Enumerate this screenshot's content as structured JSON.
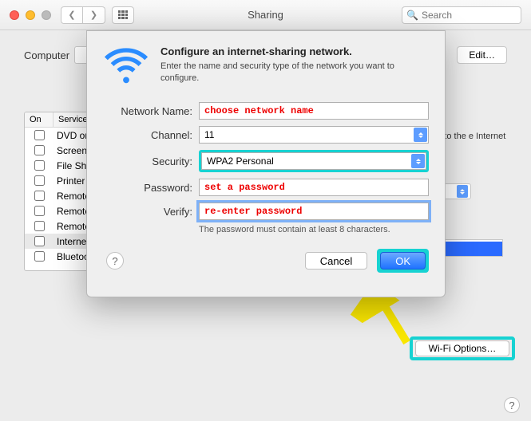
{
  "window": {
    "title": "Sharing",
    "search_placeholder": "Search",
    "computer_label": "Computer",
    "edit_button": "Edit…"
  },
  "services": {
    "col_on": "On",
    "col_service": "Service",
    "items": [
      {
        "label": "DVD or"
      },
      {
        "label": "Screen"
      },
      {
        "label": "File Sha"
      },
      {
        "label": "Printer"
      },
      {
        "label": "Remote"
      },
      {
        "label": "Remote"
      },
      {
        "label": "Remote"
      },
      {
        "label": "Internet",
        "selected": true
      },
      {
        "label": "Bluetoo"
      }
    ]
  },
  "right_info": "ction to the e Internet",
  "wifi_options_button": "Wi-Fi Options…",
  "sheet": {
    "title": "Configure an internet-sharing network.",
    "subtitle": "Enter the name and security type of the network you want to configure.",
    "labels": {
      "network_name": "Network Name:",
      "channel": "Channel:",
      "security": "Security:",
      "password": "Password:",
      "verify": "Verify:"
    },
    "values": {
      "network_name": "choose network name",
      "channel": "11",
      "security": "WPA2 Personal",
      "password": "set a password",
      "verify": "re-enter password"
    },
    "hint": "The password must contain at least 8 characters.",
    "cancel": "Cancel",
    "ok": "OK"
  },
  "annotation_colors": {
    "highlight": "#17d2d2",
    "arrow": "#f9e600"
  }
}
